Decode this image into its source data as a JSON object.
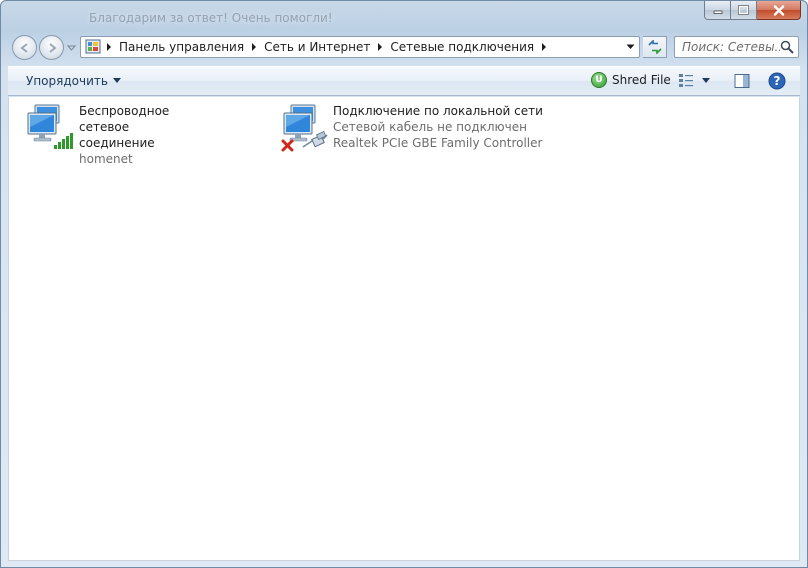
{
  "window": {
    "title": "Благодарим за ответ! Очень помогли!"
  },
  "address": {
    "crumbs": [
      "Панель управления",
      "Сеть и Интернет",
      "Сетевые подключения"
    ]
  },
  "search": {
    "placeholder": "Поиск: Сетевы..."
  },
  "toolbar": {
    "organize_label": "Упорядочить",
    "shred_label": "Shred File",
    "shred_icon_letter": "U"
  },
  "connections": [
    {
      "name_line1": "Беспроводное сетевое",
      "name_line2": "соединение",
      "status": "homenet",
      "icon": "wireless-network-icon"
    },
    {
      "name_line1": "Подключение по локальной сети",
      "status": "Сетевой кабель не подключен",
      "adapter": "Realtek PCIe GBE Family Controller",
      "icon": "lan-network-icon"
    }
  ],
  "colors": {
    "accent": "#1e3a5a",
    "close_button": "#c24b2b",
    "signal_green": "#2f9a2a",
    "error_red": "#d2261b"
  }
}
